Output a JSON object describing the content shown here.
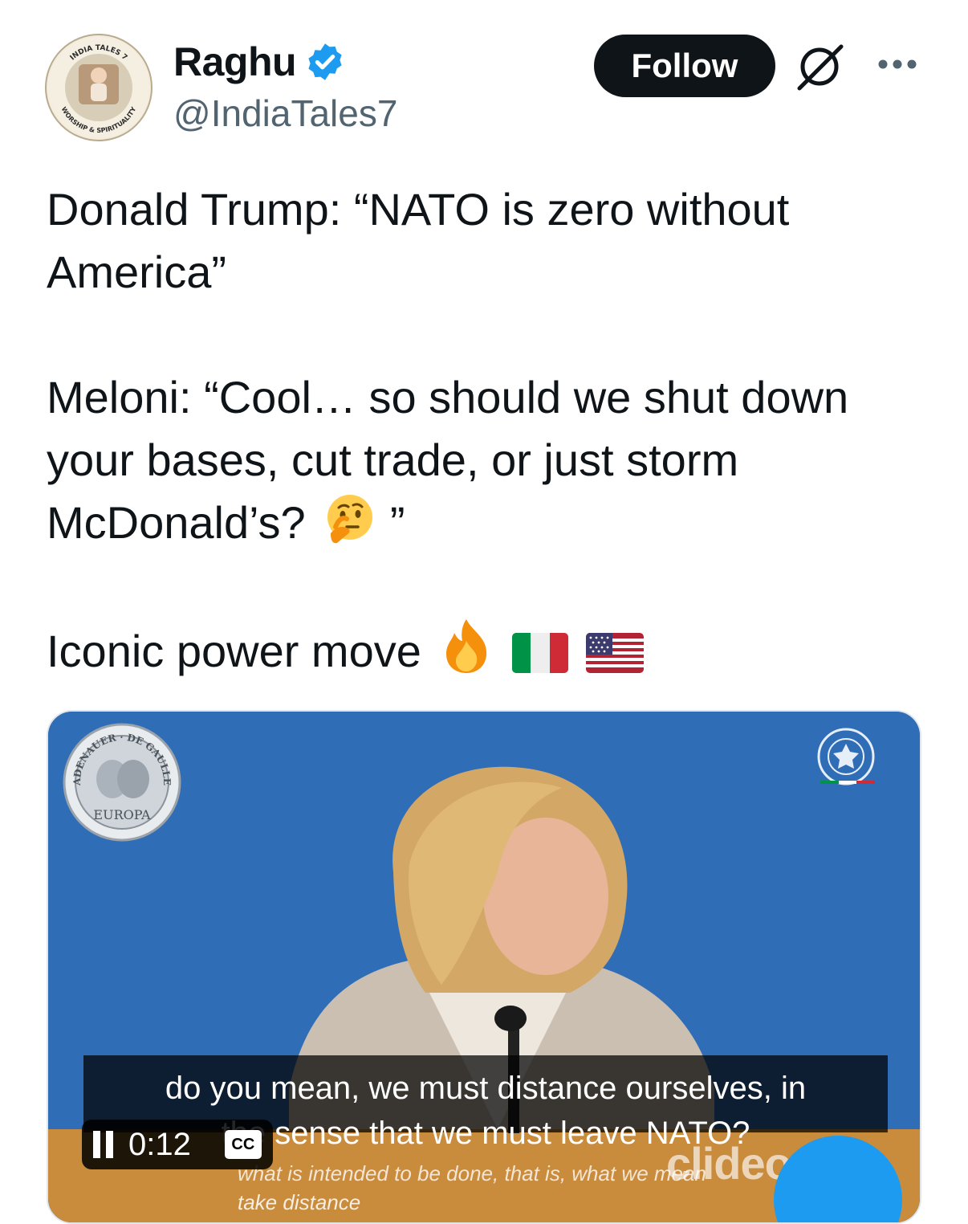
{
  "author": {
    "name": "Raghu",
    "handle": "@IndiaTales7",
    "avatar_ring_top": "INDIA TALES 7",
    "avatar_ring_bottom": "WORSHIP & SPIRITUALITY",
    "verified": true
  },
  "actions": {
    "follow_label": "Follow",
    "grok_icon": "grok-icon",
    "more_icon": "more-icon"
  },
  "tweet": {
    "para1": "Donald Trump: “NATO is zero without America”",
    "para2_main": "Meloni: “Cool… so should we shut down your bases, cut trade, or just storm McDonald’s?",
    "para2_end": "”",
    "para2_emoji": "thinking-face",
    "para3": "Iconic power move",
    "para3_emojis": [
      "fire",
      "flag-italy",
      "flag-usa"
    ]
  },
  "video": {
    "coin_text_top": "ADENAUER · DE GAULLE",
    "coin_text_bottom": "EUROPA",
    "caption_line1": "do you mean, we must distance ourselves, in",
    "caption_line2": "the sense that we must leave NATO?",
    "burned_sub_line1": "what is intended to be done, that is, what we mean",
    "burned_sub_line2": "take distance",
    "watermark": "clideo",
    "timecode": "0:12",
    "cc_label": "CC",
    "colors": {
      "background": "#2f6db6",
      "accent": "#1d9bf0"
    }
  }
}
